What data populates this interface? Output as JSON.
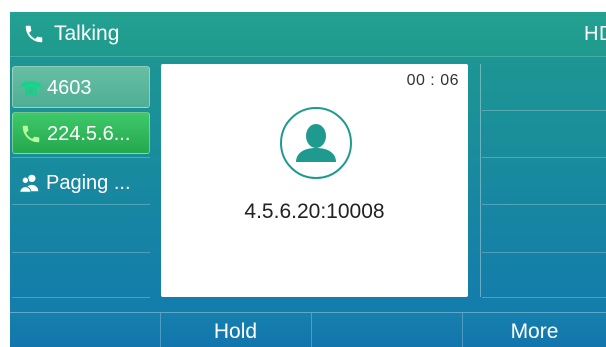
{
  "status_bar": {
    "title": "Talking",
    "hd": "HD"
  },
  "line_keys": [
    {
      "label": "4603",
      "icon": "line-phone-icon"
    },
    {
      "label": "224.5.6...",
      "icon": "handset-icon"
    },
    {
      "label": "Paging ...",
      "icon": "paging-users-icon"
    }
  ],
  "call": {
    "timer": "00 : 06",
    "callee": "4.5.6.20:10008",
    "avatar_icon": "contact-avatar-icon"
  },
  "softkeys": [
    "",
    "Hold",
    "",
    "More"
  ],
  "colors": {
    "accent": "#1f9a8f",
    "active_line": "#2db356",
    "screen_bottom": "#127ab0"
  }
}
